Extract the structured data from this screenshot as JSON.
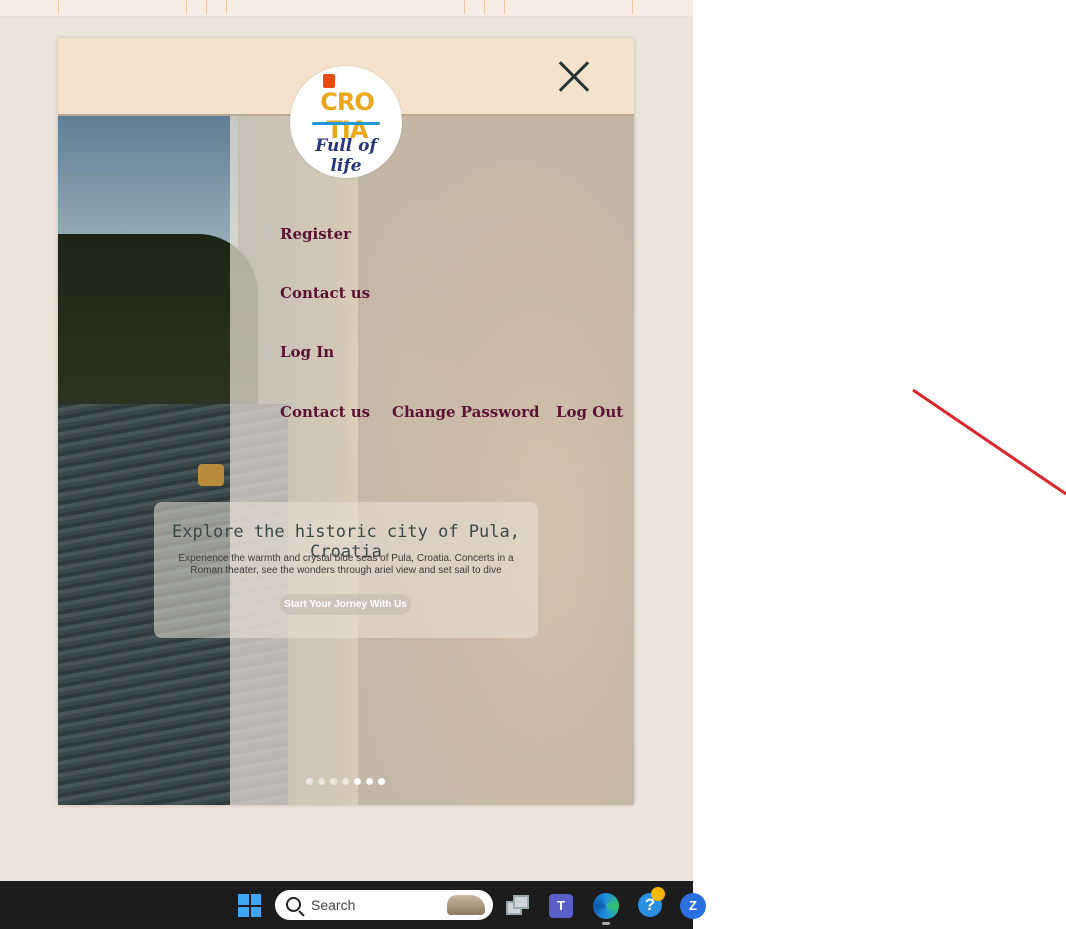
{
  "logo": {
    "brand": "CRO TIA",
    "tagline": "Full of life"
  },
  "nav": {
    "register": "Register",
    "contact_us": "Contact us",
    "log_in": "Log In",
    "contact_us_2": "Contact us",
    "change_password": "Change Password",
    "log_out": "Log Out"
  },
  "hero": {
    "title": "Explore the historic city of Pula, Croatia",
    "text": "Experience the warmth and crystal blue seas of Pula, Croatia. Concerts in a Roman theater, see the wonders through ariel view and set sail to dive",
    "button": "Start Your Jorney With Us"
  },
  "carousel": {
    "dot_count": 7,
    "active_index": 4
  },
  "taskbar": {
    "search_placeholder": "Search",
    "teams_letter": "T",
    "help_symbol": "?",
    "zoom_letter": "Z"
  },
  "colors": {
    "nav_link": "#5c1235",
    "menu_header": "#f4e2cc",
    "annotation_line": "#d9262a",
    "taskbar": "#1c1c1c"
  }
}
